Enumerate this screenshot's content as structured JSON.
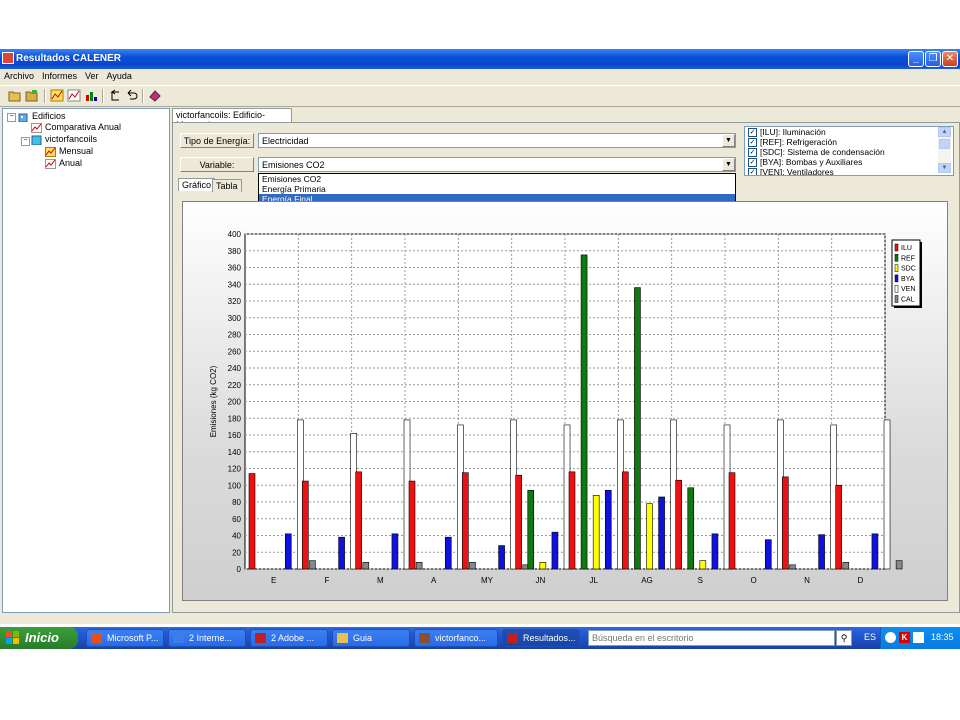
{
  "window": {
    "title": "Resultados CALENER",
    "menu": [
      "Archivo",
      "Informes",
      "Ver",
      "Ayuda"
    ]
  },
  "tree": {
    "root": "Edificios",
    "items": [
      "Comparativa Anual",
      "victorfancoils",
      "Mensual",
      "Anual"
    ]
  },
  "document": {
    "tab": "victorfancoils: Edificio-Mensual",
    "tipo_label": "Tipo de Energía:",
    "tipo_value": "Electricidad",
    "variable_label": "Variable:",
    "variable_value": "Emisiones CO2",
    "dropdown_options": [
      "Emisiones CO2",
      "Energía Primaria",
      "Energía Final"
    ],
    "dropdown_selected": "Energía Final",
    "subtabs": [
      "Gráfico",
      "Tabla"
    ],
    "checklist": [
      {
        "label": "[ILU]: Iluminación",
        "checked": true
      },
      {
        "label": "[REF]: Refrigeración",
        "checked": true
      },
      {
        "label": "[SDC]: Sistema de condensación",
        "checked": true
      },
      {
        "label": "[BYA]: Bombas y Auxiliares",
        "checked": true
      },
      {
        "label": "[VEN]: Ventiladores",
        "checked": true
      }
    ]
  },
  "chart_data": {
    "type": "bar",
    "ylabel": "Emisiones (kg CO2)",
    "ylim": [
      0,
      400
    ],
    "yticks": [
      0,
      20,
      40,
      60,
      80,
      100,
      120,
      140,
      160,
      180,
      200,
      220,
      240,
      260,
      280,
      300,
      320,
      340,
      360,
      380,
      400
    ],
    "categories": [
      "E",
      "F",
      "M",
      "A",
      "MY",
      "JN",
      "JL",
      "AG",
      "S",
      "O",
      "N",
      "D"
    ],
    "legend_position": "top-right",
    "grid": true,
    "series": [
      {
        "name": "ILU",
        "color": "#ee1111",
        "values": [
          114,
          105,
          116,
          105,
          115,
          112,
          116,
          116,
          106,
          115,
          110,
          100
        ]
      },
      {
        "name": "REF",
        "color": "#117711",
        "values": [
          0,
          0,
          0,
          0,
          0,
          94,
          375,
          336,
          97,
          0,
          0,
          0
        ]
      },
      {
        "name": "SDC",
        "color": "#ffff00",
        "values": [
          0,
          0,
          0,
          0,
          0,
          8,
          88,
          78,
          10,
          0,
          0,
          0
        ]
      },
      {
        "name": "BYA",
        "color": "#1111dd",
        "values": [
          42,
          38,
          42,
          38,
          28,
          44,
          94,
          86,
          42,
          35,
          41,
          42
        ]
      },
      {
        "name": "VEN",
        "color": "#ffffff",
        "values": [
          178,
          162,
          178,
          172,
          178,
          172,
          178,
          178,
          172,
          178,
          172,
          178
        ]
      },
      {
        "name": "CAL",
        "color": "#888888",
        "values": [
          10,
          8,
          8,
          8,
          5,
          0,
          0,
          0,
          0,
          5,
          8,
          10
        ]
      }
    ]
  },
  "taskbar": {
    "start": "Inicio",
    "tasks": [
      "Microsoft P...",
      "2 Interne...",
      "2 Adobe ...",
      "Guia",
      "victorfanco...",
      "Resultados..."
    ],
    "search_placeholder": "Búsqueda en el escritorio",
    "lang": "ES",
    "time": "18:35"
  }
}
